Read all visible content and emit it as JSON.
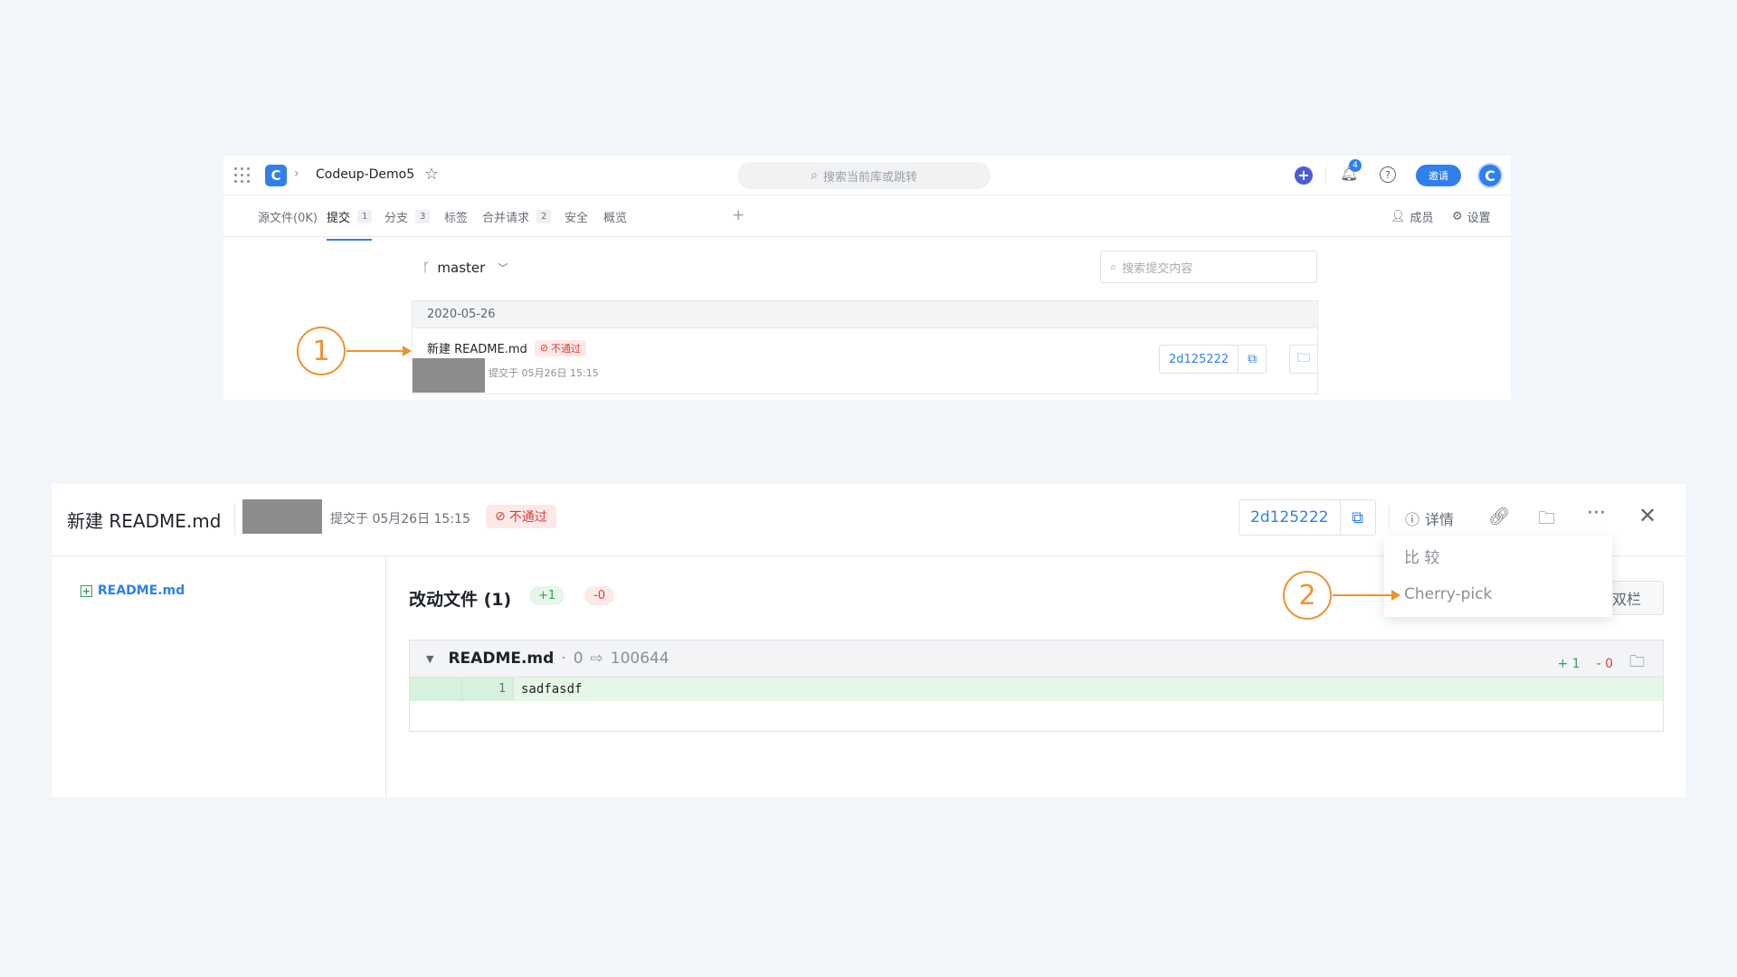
{
  "top": {
    "repo_name": "Codeup-Demo5",
    "global_search_placeholder": "搜索当前库或跳转",
    "bell_count": "4",
    "invite_label": "邀请",
    "tabs": [
      {
        "label": "源文件(0K)",
        "count": ""
      },
      {
        "label": "提交",
        "count": "1"
      },
      {
        "label": "分支",
        "count": "3"
      },
      {
        "label": "标签",
        "count": ""
      },
      {
        "label": "合并请求",
        "count": "2"
      },
      {
        "label": "安全",
        "count": ""
      },
      {
        "label": "概览",
        "count": ""
      }
    ],
    "members_label": "成员",
    "settings_label": "设置",
    "branch": "master",
    "commit_search_placeholder": "搜索提交内容",
    "date_group": "2020-05-26",
    "commit": {
      "title": "新建 README.md",
      "status": "不通过",
      "time": "提交于 05月26日 15:15",
      "hash": "2d125222"
    }
  },
  "detail": {
    "title": "新建 README.md",
    "time": "提交于 05月26日 15:15",
    "status": "不通过",
    "hash": "2d125222",
    "details_label": "详情",
    "sidebar_file": "README.md",
    "changes_title": "改动文件 (1)",
    "additions": "+1",
    "deletions": "-0",
    "dual_label": "双栏",
    "diff": {
      "file": "README.md",
      "sep": "·",
      "old_mode": "0",
      "new_mode": "100644",
      "plus": "+ 1",
      "minus": "- 0",
      "line_no": "1",
      "line_code": "sadfasdf"
    },
    "menu": [
      "比 较",
      "Cherry-pick"
    ]
  },
  "callouts": [
    "1",
    "2"
  ],
  "colors": {
    "accent": "#2f80ed",
    "callout": "#f0922e",
    "fail": "#e03b31",
    "add": "#2ea44f"
  }
}
